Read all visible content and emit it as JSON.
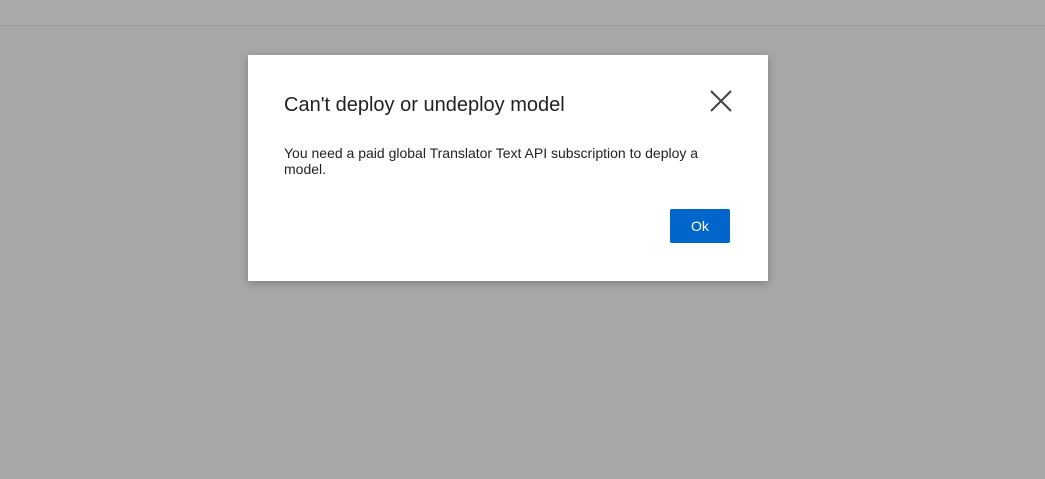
{
  "dialog": {
    "title": "Can't deploy or undeploy model",
    "message": "You need a paid global Translator Text API subscription to deploy a model.",
    "ok_label": "Ok",
    "close_icon": "close-icon"
  },
  "colors": {
    "overlay": "#a7a7a7",
    "dialog_background": "#ffffff",
    "primary_button": "#0066cc",
    "text": "#222222"
  }
}
